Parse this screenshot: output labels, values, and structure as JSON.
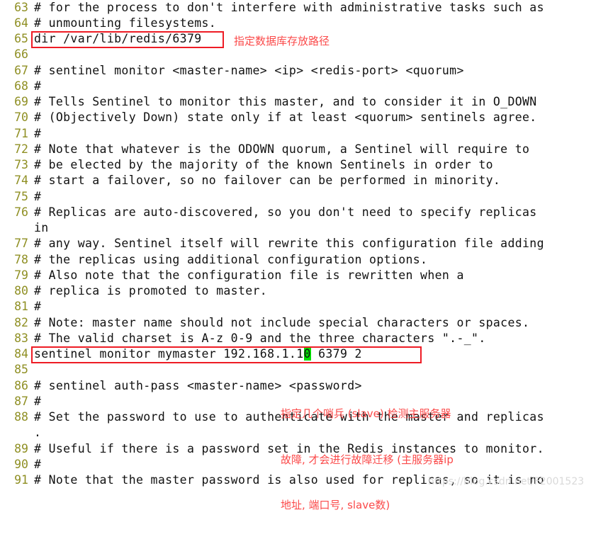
{
  "editor": {
    "line_number_color": "#8f8f23",
    "code_color": "#111111",
    "background": "#ffffff",
    "annotation_color": "#fb4a4a",
    "box_color": "#ee1c25",
    "cursor_highlight_color": "#00e000",
    "lines": [
      {
        "num": "63",
        "text": "# for the process to don't interfere with administrative tasks such as"
      },
      {
        "num": "64",
        "text": "# unmounting filesystems."
      },
      {
        "num": "65",
        "text": "dir /var/lib/redis/6379"
      },
      {
        "num": "66",
        "text": ""
      },
      {
        "num": "67",
        "text": "# sentinel monitor <master-name> <ip> <redis-port> <quorum>"
      },
      {
        "num": "68",
        "text": "#"
      },
      {
        "num": "69",
        "text": "# Tells Sentinel to monitor this master, and to consider it in O_DOWN"
      },
      {
        "num": "70",
        "text": "# (Objectively Down) state only if at least <quorum> sentinels agree."
      },
      {
        "num": "71",
        "text": "#"
      },
      {
        "num": "72",
        "text": "# Note that whatever is the ODOWN quorum, a Sentinel will require to"
      },
      {
        "num": "73",
        "text": "# be elected by the majority of the known Sentinels in order to"
      },
      {
        "num": "74",
        "text": "# start a failover, so no failover can be performed in minority."
      },
      {
        "num": "75",
        "text": "#"
      },
      {
        "num": "76",
        "text": "# Replicas are auto-discovered, so you don't need to specify replicas"
      },
      {
        "num": "",
        "text": "in"
      },
      {
        "num": "77",
        "text": "# any way. Sentinel itself will rewrite this configuration file adding"
      },
      {
        "num": "78",
        "text": "# the replicas using additional configuration options."
      },
      {
        "num": "79",
        "text": "# Also note that the configuration file is rewritten when a"
      },
      {
        "num": "80",
        "text": "# replica is promoted to master."
      },
      {
        "num": "81",
        "text": "#"
      },
      {
        "num": "82",
        "text": "# Note: master name should not include special characters or spaces."
      },
      {
        "num": "83",
        "text": "# The valid charset is A-z 0-9 and the three characters \".-_\"."
      },
      {
        "num": "84",
        "text": "sentinel monitor mymaster 192.168.1.1"
      },
      {
        "num": "85",
        "text": ""
      },
      {
        "num": "86",
        "text": "# sentinel auth-pass <master-name> <password>"
      },
      {
        "num": "87",
        "text": "#"
      },
      {
        "num": "88",
        "text": "# Set the password to use to authenticate with the master and replicas"
      },
      {
        "num": "",
        "text": "."
      },
      {
        "num": "89",
        "text": "# Useful if there is a password set in the Redis instances to monitor."
      },
      {
        "num": "90",
        "text": "#"
      },
      {
        "num": "91",
        "text": "# Note that the master password is also used for replicas, so it is no"
      }
    ],
    "line_84": {
      "prefix": "sentinel monitor mymaster 192.168.1.1",
      "cursor_char": "0",
      "suffix": " 6379 2"
    }
  },
  "annotations": [
    {
      "id": "dir-note",
      "text": "指定数据库存放路径"
    },
    {
      "id": "sentinel-monitor-note",
      "line1": "指定几个哨兵 (slave) 检测主服务器",
      "line2": "故障, 才会进行故障迁移 (主服务器ip",
      "line3": "地址, 端口号, slave数)"
    }
  ],
  "watermark": {
    "text": "https://blog.csdn.net/F2001523"
  }
}
